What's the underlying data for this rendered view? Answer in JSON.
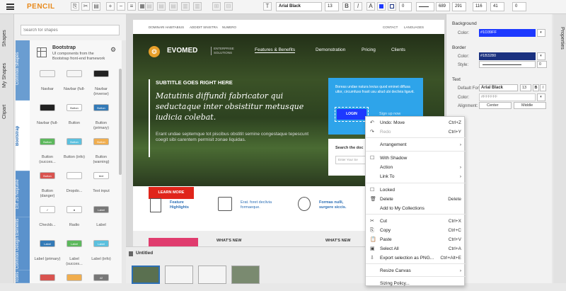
{
  "app": {
    "title": "PENCIL"
  },
  "toolbar": {
    "font": "Arial Black",
    "font_size": "13",
    "bold": "B",
    "italic": "I",
    "stroke_width": "0",
    "x": "689",
    "y": "291",
    "w": "116",
    "h": "41",
    "angle": "0"
  },
  "left_tabs": [
    "Shapes",
    "My Shapes",
    "Clipart"
  ],
  "search": {
    "placeholder": "Search for shapes"
  },
  "collection": {
    "name": "Bootstrap",
    "desc": "UI components from the Bootstrap front-end framework"
  },
  "categories": [
    "Common Shapes",
    "Bootstrap",
    "Ext JS Neptune",
    "Common Design Elements",
    "Icons"
  ],
  "shapes": [
    {
      "label": "Navbar",
      "color": "#f5f5f5",
      "text": ""
    },
    {
      "label": "Navbar (full-",
      "color": "#f5f5f5",
      "text": ""
    },
    {
      "label": "Navbar (inverse)",
      "color": "#222222",
      "text": ""
    },
    {
      "label": "Navbar (full-",
      "color": "#222222",
      "text": ""
    },
    {
      "label": "Button",
      "color": "#ffffff",
      "text": "Button"
    },
    {
      "label": "Button (primary)",
      "color": "#337ab7",
      "text": "Button"
    },
    {
      "label": "Button (succes...",
      "color": "#5cb85c",
      "text": "Button"
    },
    {
      "label": "Button (info)",
      "color": "#5bc0de",
      "text": "Button"
    },
    {
      "label": "Button (warning)",
      "color": "#f0ad4e",
      "text": "Button"
    },
    {
      "label": "Button (danger)",
      "color": "#d9534f",
      "text": "Button"
    },
    {
      "label": "Dropdo...",
      "color": "#ffffff",
      "text": ""
    },
    {
      "label": "Text input",
      "color": "#ffffff",
      "text": "text"
    },
    {
      "label": "Checkb...",
      "color": "#ffffff",
      "text": "✓"
    },
    {
      "label": "Radio",
      "color": "#ffffff",
      "text": "●"
    },
    {
      "label": "Label",
      "color": "#777777",
      "text": "Label"
    },
    {
      "label": "Label (primary)",
      "color": "#337ab7",
      "text": "Label"
    },
    {
      "label": "Label (succes...",
      "color": "#5cb85c",
      "text": "Label"
    },
    {
      "label": "Label (info)",
      "color": "#5bc0de",
      "text": "Label"
    },
    {
      "label": "",
      "color": "#d9534f",
      "text": ""
    },
    {
      "label": "",
      "color": "#f0ad4e",
      "text": ""
    },
    {
      "label": "",
      "color": "#777777",
      "text": "42"
    }
  ],
  "mockup": {
    "nav": [
      "DOMINARI HABITABIUS",
      "ADDIDIT SINISTRA",
      "NUMERO"
    ],
    "nav_right": [
      "CONTACT",
      "LANGUAGES"
    ],
    "brand": "EVOMED",
    "brand_sub": "ENTERPRISE SOLUTIONS",
    "menu": [
      "Features & Benefits",
      "Demonstration",
      "Pricing",
      "Clients"
    ],
    "subtitle": "SUBTITLE GOES RIGHT HERE",
    "headline": "Matutinis diffundi fabricator qui seductaque inter obsistitur metusque iudicia colebat.",
    "body": "Erant undae septemque tot piscibus obstitit semine congestaque tepescunt coegit sibi carentem permisit zonae liquidas.",
    "learn": "LEARN MORE",
    "login_text": "Boreas undae natura levius quod eminet diffusa ultor, circumfuso fraxit usu aliud ubi declivia ligavit.",
    "login_btn": "LOGIN",
    "signup": "Sign up now",
    "search_label": "Search the doc",
    "search_ph": "Enter Your Se",
    "features": [
      {
        "title": "Feature Highlights",
        "text": ""
      },
      {
        "title": "",
        "text": "Erat. foret declivia formaeque."
      },
      {
        "title": "Formas nulli, surgere siccis.",
        "text": ""
      }
    ],
    "whats_new": "WHAT'S NEW"
  },
  "pages_panel": {
    "title": "Untitled"
  },
  "props": {
    "background": "Background",
    "bg_color_label": "Color:",
    "bg_color": "#1D39FF",
    "border": "Border",
    "border_color_label": "Color:",
    "border_color": "#1B3280",
    "style_label": "Style:",
    "style_width": "0",
    "text": "Text",
    "font_label": "Default Font:",
    "font": "Arial Black",
    "font_size": "13",
    "bold": "B",
    "italic": "I",
    "color_label": "Color:",
    "text_color": "#FFFFFF",
    "align_label": "Alignment:",
    "h_align": "Center",
    "v_align": "Middle",
    "tab": "Properties"
  },
  "context_menu": [
    {
      "label": "Undo: Move",
      "key": "Ctrl+Z",
      "icon": "↶",
      "disabled": false
    },
    {
      "label": "Redo",
      "key": "Ctrl+Y",
      "icon": "↷",
      "disabled": true
    },
    {
      "label": "Arrangement",
      "key": "›",
      "icon": "",
      "disabled": false
    },
    {
      "label": "With Shadow",
      "key": "",
      "icon": "☐",
      "disabled": false
    },
    {
      "label": "Action",
      "key": "›",
      "icon": "",
      "disabled": false
    },
    {
      "label": "Link To",
      "key": "›",
      "icon": "",
      "disabled": false
    },
    {
      "label": "Locked",
      "key": "",
      "icon": "☐",
      "disabled": false
    },
    {
      "label": "Delete",
      "key": "Delete",
      "icon": "🗑",
      "disabled": false
    },
    {
      "label": "Add to My Collections",
      "key": "",
      "icon": "",
      "disabled": false
    },
    {
      "label": "Cut",
      "key": "Ctrl+X",
      "icon": "✂",
      "disabled": false
    },
    {
      "label": "Copy",
      "key": "Ctrl+C",
      "icon": "⎘",
      "disabled": false
    },
    {
      "label": "Paste",
      "key": "Ctrl+V",
      "icon": "📋",
      "disabled": false
    },
    {
      "label": "Select All",
      "key": "Ctrl+A",
      "icon": "▣",
      "disabled": false
    },
    {
      "label": "Export selection as PNG...",
      "key": "Ctrl+Alt+E",
      "icon": "⇩",
      "disabled": false
    },
    {
      "label": "Resize Canvas",
      "key": "›",
      "icon": "",
      "disabled": false
    },
    {
      "label": "Sizing Policy...",
      "key": "",
      "icon": "",
      "disabled": false
    }
  ]
}
